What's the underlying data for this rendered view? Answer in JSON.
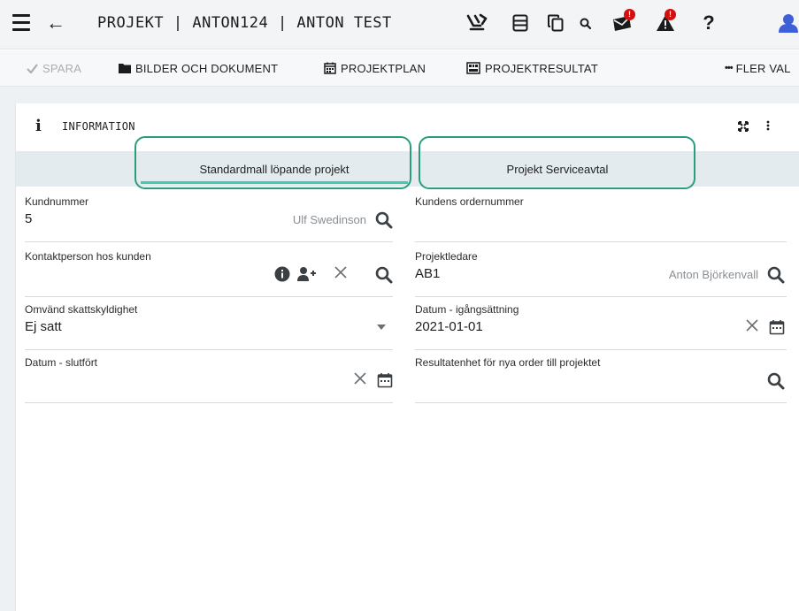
{
  "header": {
    "title": "PROJEKT | ANTON124 | ANTON TEST",
    "icons": [
      "menu-icon",
      "back-arrow-icon",
      "transfer-icon",
      "server-icon",
      "copy-icon",
      "search-icon",
      "mail-icon",
      "alert-icon",
      "help-icon",
      "user-avatar-icon"
    ],
    "mail_badge": "!",
    "alert_badge": "!",
    "help_glyph": "?"
  },
  "toolbar": {
    "save_label": "SPARA",
    "media_label": "BILDER OCH DOKUMENT",
    "plan_label": "PROJEKTPLAN",
    "result_label": "PROJEKTRESULTAT",
    "more_label": "FLER VAL"
  },
  "card": {
    "title": "INFORMATION",
    "info_glyph": "i"
  },
  "tabs": [
    {
      "label": "Standardmall löpande projekt",
      "active": true
    },
    {
      "label": "Projekt Serviceavtal",
      "active": false
    }
  ],
  "fields": {
    "kundnummer": {
      "label": "Kundnummer",
      "value": "5",
      "hint": "Ulf Swedinson"
    },
    "kundens_ordernummer": {
      "label": "Kundens ordernummer",
      "value": ""
    },
    "kontaktperson": {
      "label": "Kontaktperson hos kunden",
      "value": ""
    },
    "projektledare": {
      "label": "Projektledare",
      "value": "AB1",
      "hint": "Anton Björkenvall"
    },
    "omvand_skatt": {
      "label": "Omvänd skattskyldighet",
      "value": "Ej satt"
    },
    "datum_igang": {
      "label": "Datum - igångsättning",
      "value": "2021-01-01"
    },
    "datum_slutfort": {
      "label": "Datum - slutfört",
      "value": ""
    },
    "resultatenhet": {
      "label": "Resultatenhet för nya order till projektet",
      "value": ""
    }
  },
  "colors": {
    "accent": "#3ecbb0",
    "highlight_outline": "#2a9d7e",
    "badge_red": "#d40d0d",
    "tab_strip": "#e4ebee",
    "avatar_blue": "#3f5fd8"
  }
}
